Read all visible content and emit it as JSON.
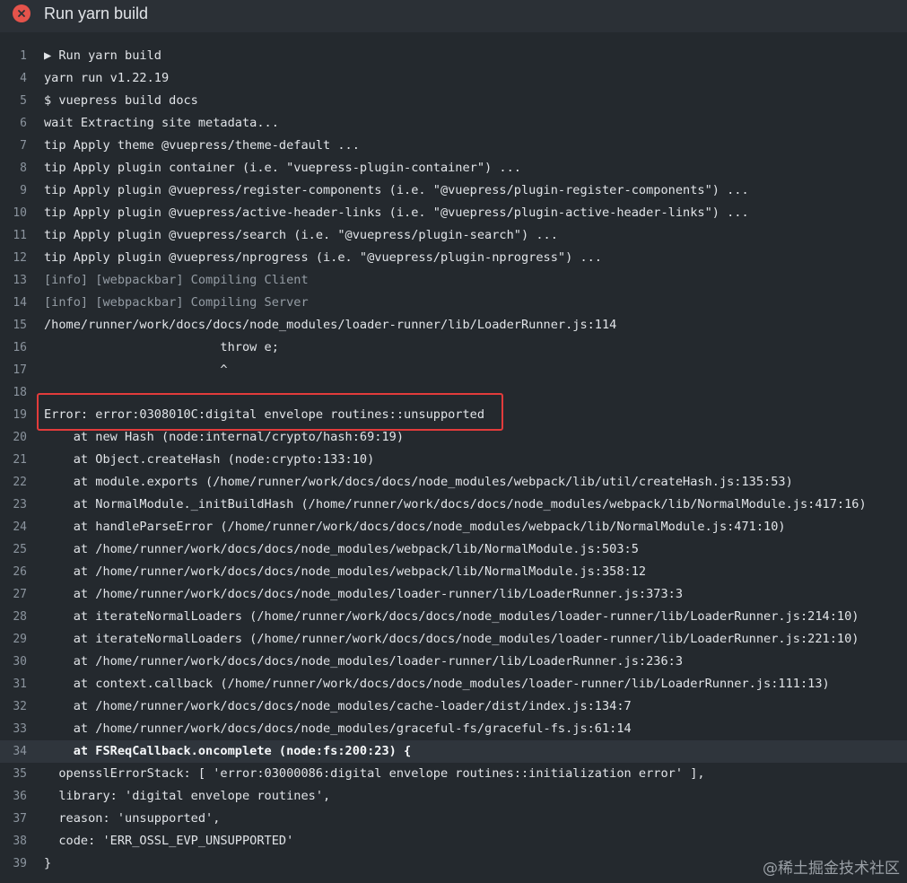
{
  "header": {
    "title": "Run yarn build",
    "status_icon": "error-x-icon",
    "status_color": "#e5534b"
  },
  "log": [
    {
      "num": "1",
      "text": "▶ Run yarn build",
      "style": "normal"
    },
    {
      "num": "4",
      "text": "yarn run v1.22.19",
      "style": "normal"
    },
    {
      "num": "5",
      "text": "$ vuepress build docs",
      "style": "normal"
    },
    {
      "num": "6",
      "text": "wait Extracting site metadata...",
      "style": "normal"
    },
    {
      "num": "7",
      "text": "tip Apply theme @vuepress/theme-default ...",
      "style": "normal"
    },
    {
      "num": "8",
      "text": "tip Apply plugin container (i.e. \"vuepress-plugin-container\") ...",
      "style": "normal"
    },
    {
      "num": "9",
      "text": "tip Apply plugin @vuepress/register-components (i.e. \"@vuepress/plugin-register-components\") ...",
      "style": "normal"
    },
    {
      "num": "10",
      "text": "tip Apply plugin @vuepress/active-header-links (i.e. \"@vuepress/plugin-active-header-links\") ...",
      "style": "normal"
    },
    {
      "num": "11",
      "text": "tip Apply plugin @vuepress/search (i.e. \"@vuepress/plugin-search\") ...",
      "style": "normal"
    },
    {
      "num": "12",
      "text": "tip Apply plugin @vuepress/nprogress (i.e. \"@vuepress/plugin-nprogress\") ...",
      "style": "normal"
    },
    {
      "num": "13",
      "text": "[info] [webpackbar] Compiling Client",
      "style": "info"
    },
    {
      "num": "14",
      "text": "[info] [webpackbar] Compiling Server",
      "style": "info"
    },
    {
      "num": "15",
      "text": "/home/runner/work/docs/docs/node_modules/loader-runner/lib/LoaderRunner.js:114",
      "style": "normal"
    },
    {
      "num": "16",
      "text": "                        throw e;",
      "style": "normal"
    },
    {
      "num": "17",
      "text": "                        ^",
      "style": "normal"
    },
    {
      "num": "18",
      "text": "",
      "style": "normal"
    },
    {
      "num": "19",
      "text": "Error: error:0308010C:digital envelope routines::unsupported",
      "style": "normal"
    },
    {
      "num": "20",
      "text": "    at new Hash (node:internal/crypto/hash:69:19)",
      "style": "normal"
    },
    {
      "num": "21",
      "text": "    at Object.createHash (node:crypto:133:10)",
      "style": "normal"
    },
    {
      "num": "22",
      "text": "    at module.exports (/home/runner/work/docs/docs/node_modules/webpack/lib/util/createHash.js:135:53)",
      "style": "normal"
    },
    {
      "num": "23",
      "text": "    at NormalModule._initBuildHash (/home/runner/work/docs/docs/node_modules/webpack/lib/NormalModule.js:417:16)",
      "style": "normal"
    },
    {
      "num": "24",
      "text": "    at handleParseError (/home/runner/work/docs/docs/node_modules/webpack/lib/NormalModule.js:471:10)",
      "style": "normal"
    },
    {
      "num": "25",
      "text": "    at /home/runner/work/docs/docs/node_modules/webpack/lib/NormalModule.js:503:5",
      "style": "normal"
    },
    {
      "num": "26",
      "text": "    at /home/runner/work/docs/docs/node_modules/webpack/lib/NormalModule.js:358:12",
      "style": "normal"
    },
    {
      "num": "27",
      "text": "    at /home/runner/work/docs/docs/node_modules/loader-runner/lib/LoaderRunner.js:373:3",
      "style": "normal"
    },
    {
      "num": "28",
      "text": "    at iterateNormalLoaders (/home/runner/work/docs/docs/node_modules/loader-runner/lib/LoaderRunner.js:214:10)",
      "style": "normal"
    },
    {
      "num": "29",
      "text": "    at iterateNormalLoaders (/home/runner/work/docs/docs/node_modules/loader-runner/lib/LoaderRunner.js:221:10)",
      "style": "normal"
    },
    {
      "num": "30",
      "text": "    at /home/runner/work/docs/docs/node_modules/loader-runner/lib/LoaderRunner.js:236:3",
      "style": "normal"
    },
    {
      "num": "31",
      "text": "    at context.callback (/home/runner/work/docs/docs/node_modules/loader-runner/lib/LoaderRunner.js:111:13)",
      "style": "normal"
    },
    {
      "num": "32",
      "text": "    at /home/runner/work/docs/docs/node_modules/cache-loader/dist/index.js:134:7",
      "style": "normal"
    },
    {
      "num": "33",
      "text": "    at /home/runner/work/docs/docs/node_modules/graceful-fs/graceful-fs.js:61:14",
      "style": "normal"
    },
    {
      "num": "34",
      "text": "    at FSReqCallback.oncomplete (node:fs:200:23) {",
      "style": "highlight"
    },
    {
      "num": "35",
      "text": "  opensslErrorStack: [ 'error:03000086:digital envelope routines::initialization error' ],",
      "style": "normal"
    },
    {
      "num": "36",
      "text": "  library: 'digital envelope routines',",
      "style": "normal"
    },
    {
      "num": "37",
      "text": "  reason: 'unsupported',",
      "style": "normal"
    },
    {
      "num": "38",
      "text": "  code: 'ERR_OSSL_EVP_UNSUPPORTED'",
      "style": "normal"
    },
    {
      "num": "39",
      "text": "}",
      "style": "normal"
    }
  ],
  "annotation": {
    "box_color": "#e23b3b"
  },
  "watermark": "@稀土掘金技术社区"
}
